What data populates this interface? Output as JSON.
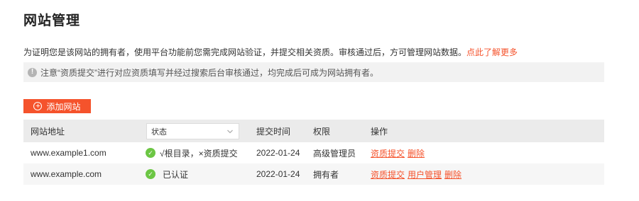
{
  "page": {
    "title": "网站管理",
    "description": "为证明您是该网站的拥有者，使用平台功能前您需完成网站验证，并提交相关资质。审核通过后，方可管理网站数据。",
    "learn_more": "点此了解更多",
    "notice_icon": "!",
    "notice": "注意“资质提交”进行对应资质填写并经过搜索后台审核通过，均完成后可成为网站拥有者。",
    "add_button": "添加网站"
  },
  "table": {
    "headers": {
      "site": "网站地址",
      "status_select": "状态",
      "time": "提交时间",
      "role": "权限",
      "actions": "操作"
    },
    "rows": [
      {
        "site": "www.example1.com",
        "status": "√根目录，×资质提交",
        "time": "2022-01-24",
        "role": "高级管理员",
        "actions": [
          "资质提交",
          "删除"
        ]
      },
      {
        "site": "www.example.com",
        "status": "已认证",
        "time": "2022-01-24",
        "role": "拥有者",
        "actions": [
          "资质提交",
          "用户管理",
          "删除"
        ]
      }
    ]
  },
  "icons": {
    "notice": "info-circle-icon",
    "add": "plus-circle-icon",
    "status": "check-circle-icon",
    "select": "chevron-down-icon"
  },
  "colors": {
    "accent": "#f5532c",
    "success": "#6cc644",
    "header_bg": "#ebebeb",
    "notice_bg": "#f2f2f2"
  }
}
